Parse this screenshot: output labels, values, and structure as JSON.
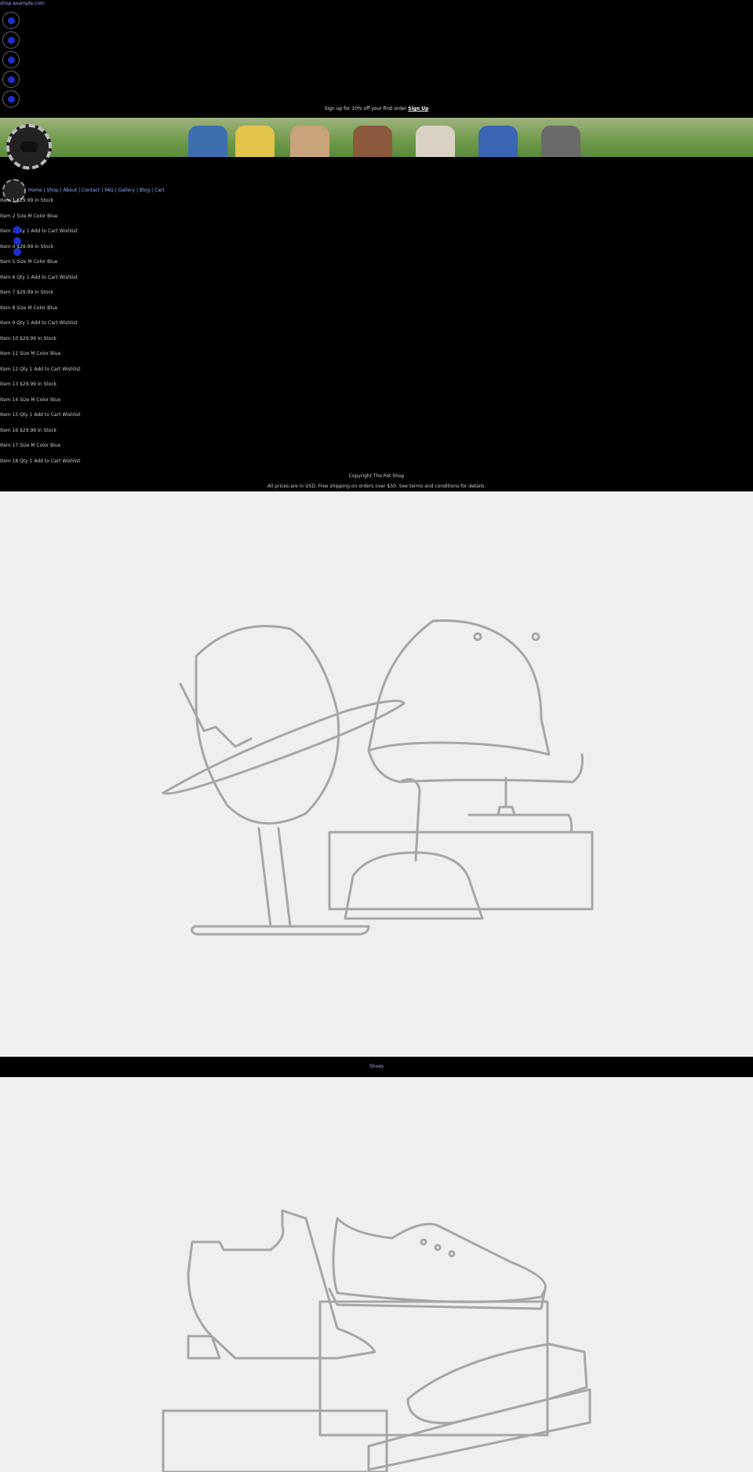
{
  "header": {
    "top_link": "shop.example.com"
  },
  "social": {
    "icons": [
      "twitter-icon",
      "facebook-icon",
      "instagram-icon",
      "youtube-icon",
      "pinterest-icon"
    ]
  },
  "announcement": {
    "text": "Sign up for 10% off your first order ",
    "link": "Sign Up"
  },
  "nav": {
    "text": "Home | Shop | About | Contact | FAQ | Gallery | Blog | Cart"
  },
  "list": {
    "rows": [
      "Item 1  $29.99  In Stock",
      "Item 2  Size  M  Color  Blue",
      "Item 3  Qty  1  Add to Cart  Wishlist",
      "Item 4  $29.99  In Stock",
      "Item 5  Size  M  Color  Blue",
      "Item 6  Qty  1  Add to Cart  Wishlist",
      "Item 7  $29.99  In Stock",
      "Item 8  Size  M  Color  Blue",
      "Item 9  Qty  1  Add to Cart  Wishlist",
      "Item 10  $29.99  In Stock",
      "Item 11  Size  M  Color  Blue",
      "Item 12  Qty  1  Add to Cart  Wishlist",
      "Item 13  $29.99  In Stock",
      "Item 14  Size  M  Color  Blue",
      "Item 15  Qty  1  Add to Cart  Wishlist",
      "Item 16  $29.99  In Stock",
      "Item 17  Size  M  Color  Blue",
      "Item 18  Qty  1  Add to Cart  Wishlist"
    ]
  },
  "footer": {
    "line1": "Copyright The Pet Shop",
    "line2": "All prices are in USD. Free shipping on orders over $50. See terms and conditions for details."
  },
  "section_bar": {
    "label": "Shoes"
  },
  "colors": {
    "link": "#9aa8ff",
    "panel_bg": "#efefef",
    "line_art": "#a6a6a6",
    "accent_blue": "#1c2fc9"
  }
}
